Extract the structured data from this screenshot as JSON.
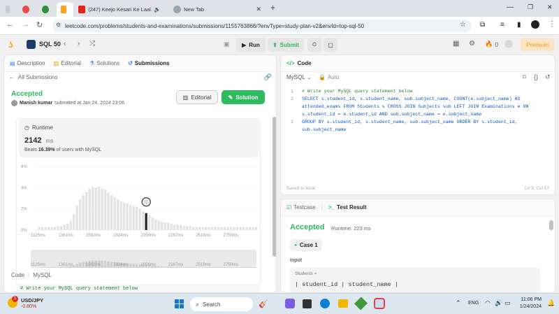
{
  "browser": {
    "tabs": [
      {
        "title": ""
      },
      {
        "title": ""
      },
      {
        "title": ""
      },
      {
        "title": "(247) Keejo Kesari Ke Laal..."
      },
      {
        "title": "New Tab"
      }
    ],
    "new_tab": "+",
    "url": "leetcode.com/problems/students-and-examinations/submissions/1155763866/?envType=study-plan-v2&envId=top-sql-50"
  },
  "header": {
    "study_plan": "SQL 50",
    "run_label": "Run",
    "submit_label": "Submit",
    "streak_count": "0",
    "premium_label": "Premium"
  },
  "left": {
    "tabs": [
      "Description",
      "Editorial",
      "Solutions",
      "Submissions"
    ],
    "back_label": "All Submissions",
    "status": "Accepted",
    "author": "Manish kumar",
    "submitted_text": "submitted at Jan 24, 2024 23:06",
    "editorial_btn": "Editorial",
    "solution_btn": "Solution",
    "runtime": {
      "label": "Runtime",
      "value": "2142",
      "unit": "ms",
      "beats_prefix": "Beats ",
      "beats_pct": "16.39%",
      "beats_suffix": " of users with MySQL"
    },
    "code_label": "Code",
    "lang_label": "MySQL",
    "code_preview": "# Write your MySQL query statement below"
  },
  "chart_data": {
    "type": "bar",
    "y_ticks": [
      "6%",
      "4%",
      "2%",
      "0%"
    ],
    "ylim": [
      0,
      6
    ],
    "x_ticks": [
      "1125ms",
      "1361ms",
      "1592ms",
      "1824ms",
      "2056ms",
      "2287ms",
      "2519ms",
      "2750ms"
    ],
    "values": [
      0.3,
      0.3,
      0.3,
      0.3,
      0.3,
      0.3,
      0.4,
      0.4,
      0.5,
      0.6,
      0.9,
      1.5,
      2.3,
      2.9,
      3.3,
      3.6,
      3.9,
      4.1,
      4.0,
      4.1,
      3.9,
      3.8,
      3.5,
      3.3,
      3.1,
      2.9,
      2.7,
      2.6,
      2.5,
      2.4,
      2.3,
      2.2,
      2.0,
      1.8,
      1.6,
      1.4,
      1.2,
      1.0,
      0.9,
      0.8,
      0.7,
      0.7,
      0.6,
      0.5,
      0.5,
      0.5,
      0.4,
      0.4,
      0.4,
      0.3,
      0.3,
      0.3,
      0.3,
      0.3,
      0.3,
      0.3,
      0.3,
      0.3,
      0.3,
      0.3,
      0.3,
      0.3,
      0.3,
      0.3,
      0.3,
      0.3,
      0.3,
      0.3,
      0.3,
      0.3
    ],
    "highlight_index": 34,
    "series": [
      {
        "values": []
      }
    ]
  },
  "editor": {
    "title": "Code",
    "language": "MySQL",
    "auto": "Auto",
    "lines": [
      {
        "n": "1",
        "text": "# Write your MySQL query statement below"
      },
      {
        "n": "2",
        "text": "SELECT s.student_id, s.student_name, sub.subject_name, COUNT(e.subject_name) AS attended_exams FROM Students s CROSS JOIN Subjects sub LEFT JOIN Examinations e ON s.student_id = e.student_id AND sub.subject_name = e.subject_name"
      },
      {
        "n": "3",
        "text": "GROUP BY s.student_id, s.student_name, sub.subject_name ORDER BY s.student_id, sub.subject_name"
      }
    ],
    "saved": "Saved to local",
    "position": "Ln 3, Col 57"
  },
  "testcase": {
    "tab1": "Testcase",
    "tab2": "Test Result",
    "status": "Accepted",
    "runtime": "Runtime: 223 ms",
    "case_label": "Case 1",
    "input_label": "Input",
    "table_name": "Students =",
    "table_preview": "| student_id | student_name |"
  },
  "taskbar": {
    "ticker_name": "USD/JPY",
    "ticker_change": "-0.80%",
    "badge": "1",
    "search": "Search",
    "lang": "ENG",
    "time": "11:06 PM",
    "date": "1/24/2024"
  }
}
